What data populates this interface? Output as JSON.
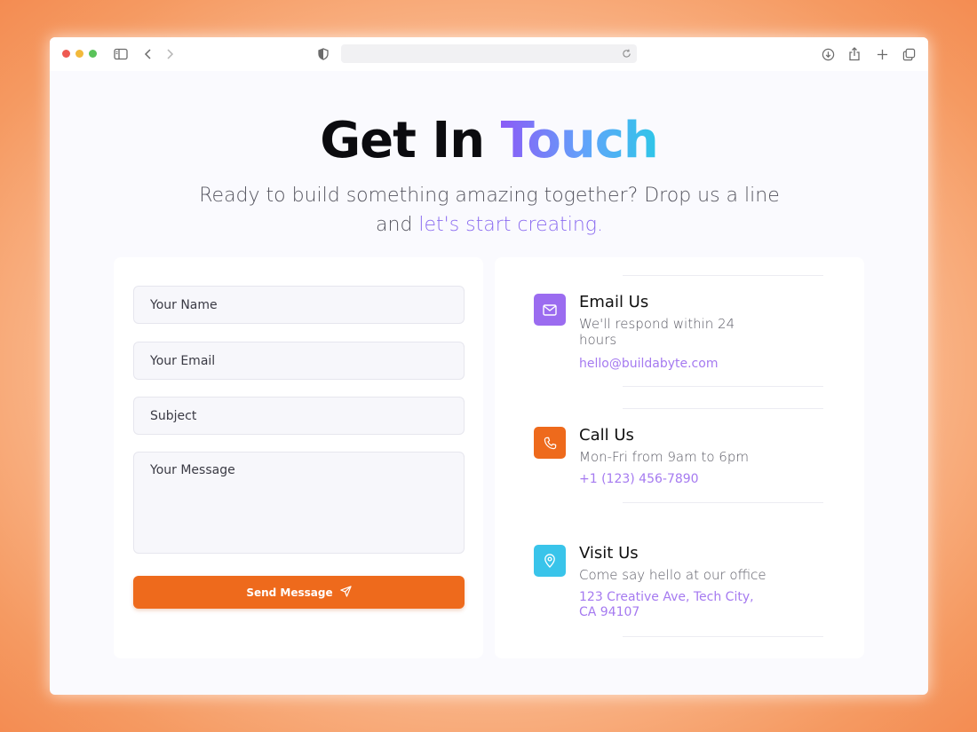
{
  "colors": {
    "accent_purple": "#8b6cf0",
    "orange": "#ee6a1c",
    "email_icon_bg": "#9b6cf0",
    "call_icon_bg": "#ee6a1c",
    "visit_icon_bg": "#39c4ea"
  },
  "browser": {
    "url": "",
    "icons": [
      "sidebar-icon",
      "back-icon",
      "forward-icon",
      "shield-icon",
      "reload-icon",
      "download-icon",
      "share-icon",
      "plus-icon",
      "tabs-icon"
    ]
  },
  "hero": {
    "title_plain": "Get In ",
    "title_accent": "Touch",
    "subtitle_plain": "Ready to build something amazing together? Drop us a line and ",
    "subtitle_accent": "let's start creating."
  },
  "form": {
    "name_placeholder": "Your Name",
    "email_placeholder": "Your Email",
    "subject_placeholder": "Subject",
    "message_placeholder": "Your Message",
    "send_label": "Send Message"
  },
  "contact": [
    {
      "icon": "mail-icon",
      "title": "Email Us",
      "description": "We'll respond within 24 hours",
      "link": "hello@buildabyte.com"
    },
    {
      "icon": "phone-icon",
      "title": "Call Us",
      "description": "Mon-Fri from 9am to 6pm",
      "link": "+1 (123) 456-7890"
    },
    {
      "icon": "map-pin-icon",
      "title": "Visit Us",
      "description": "Come say hello at our office",
      "link": "123 Creative Ave, Tech City, CA 94107"
    }
  ]
}
